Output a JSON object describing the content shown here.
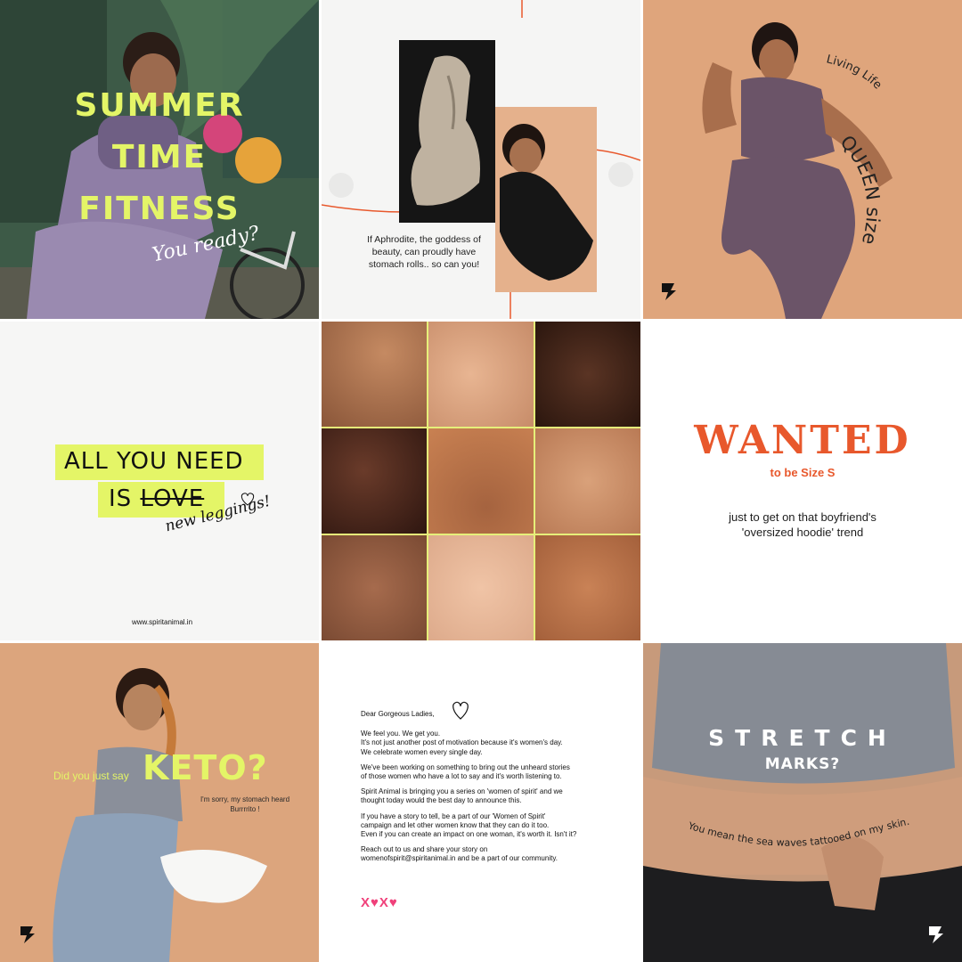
{
  "tiles": {
    "summer": {
      "headline": [
        "SUMMER",
        "TIME",
        "FITNESS"
      ],
      "script": "You ready?"
    },
    "aphrodite": {
      "caption": "If Aphrodite, the goddess of beauty, can proudly have stomach rolls.. so can you!"
    },
    "queen": {
      "text_top": "Living Life",
      "text_main": "QUEEN size"
    },
    "love": {
      "line1": "ALL YOU NEED",
      "line2_prefix": "IS ",
      "line2_struck": "LOVE",
      "script": "new leggings!",
      "url": "www.spiritanimal.in"
    },
    "wanted": {
      "title": "WANTED",
      "subtitle": "to be Size S",
      "body_line1": "just to get on that boyfriend's",
      "body_line2": "'oversized hoodie' trend"
    },
    "keto": {
      "question_prefix": "Did you just say",
      "question_word": "KETO?",
      "note": "I'm sorry, my stomach heard Burrrrito !"
    },
    "letter": {
      "greeting": "Dear Gorgeous Ladies,",
      "paragraphs": [
        "We feel you. We get you.",
        "It's not just another post of motivation because it's women's day.",
        "We celebrate women every single day.",
        "We've been working on something to bring out the unheard stories",
        "of those women who have a lot to say and it's worth listening to.",
        "Spirit Animal is bringing you a series on 'women of spirit' and we",
        "thought today would the best day to announce this.",
        "If you have a story to tell, be a part of our 'Women of Spirit'",
        "campaign and let other women know that they can do it too.",
        "Even if you can create an impact on one woman, it's worth it. Isn't it?",
        "Reach out to us and share your story on",
        "womenofspirit@spiritanimal.in and be a part of our community."
      ],
      "signoff": "X♥X♥"
    },
    "stretch": {
      "title": "STRETCH",
      "subtitle": "MARKS?",
      "curved": "You mean the sea waves tattooed on my skin."
    }
  },
  "colors": {
    "accent_lime": "#e4f567",
    "accent_orange": "#e8582c",
    "accent_pink": "#f0407a",
    "skin_tan": "#dca57d"
  }
}
